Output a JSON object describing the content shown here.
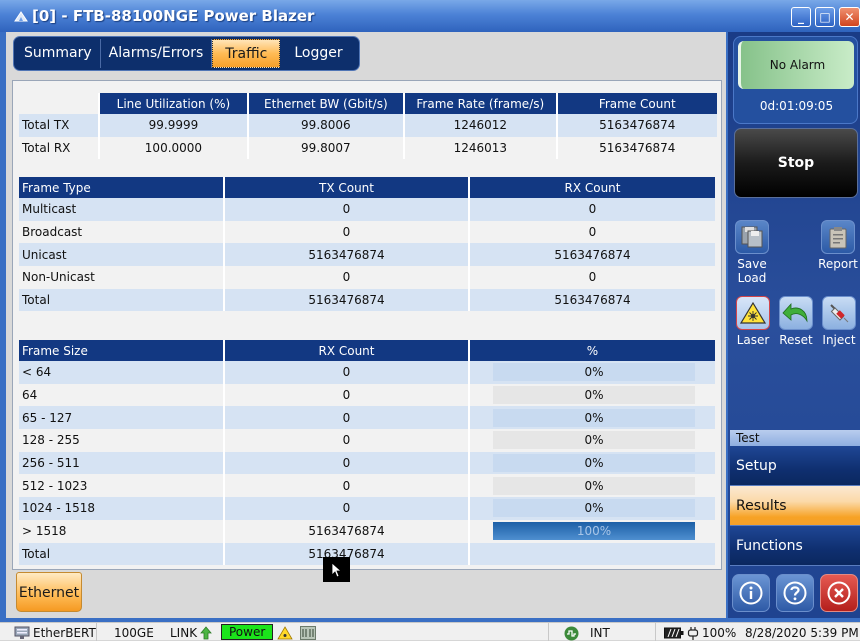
{
  "window": {
    "title": "[0] - FTB-88100NGE Power Blazer",
    "minimize_glyph": "_",
    "maximize_glyph": "□",
    "close_glyph": "✕"
  },
  "tabs": [
    {
      "label": "Summary",
      "active": false
    },
    {
      "label": "Alarms/Errors",
      "active": false
    },
    {
      "label": "Traffic",
      "active": true
    },
    {
      "label": "Logger",
      "active": false
    }
  ],
  "summary_table": {
    "headers": [
      "",
      "Line Utilization (%)",
      "Ethernet BW (Gbit/s)",
      "Frame Rate (frame/s)",
      "Frame Count"
    ],
    "rows": [
      [
        "Total TX",
        "99.9999",
        "99.8006",
        "1246012",
        "5163476874"
      ],
      [
        "Total RX",
        "100.0000",
        "99.8007",
        "1246013",
        "5163476874"
      ]
    ]
  },
  "frame_type_table": {
    "headers": [
      "Frame Type",
      "TX Count",
      "RX Count"
    ],
    "rows": [
      [
        "Multicast",
        "0",
        "0"
      ],
      [
        "Broadcast",
        "0",
        "0"
      ],
      [
        "Unicast",
        "5163476874",
        "5163476874"
      ],
      [
        "Non-Unicast",
        "0",
        "0"
      ],
      [
        "Total",
        "5163476874",
        "5163476874"
      ]
    ]
  },
  "frame_size_table": {
    "headers": [
      "Frame Size",
      "RX Count",
      "%"
    ],
    "rows": [
      {
        "size": "< 64",
        "count": "0",
        "pct_label": "0%",
        "pct": 0
      },
      {
        "size": "64",
        "count": "0",
        "pct_label": "0%",
        "pct": 0
      },
      {
        "size": "65 - 127",
        "count": "0",
        "pct_label": "0%",
        "pct": 0
      },
      {
        "size": "128 - 255",
        "count": "0",
        "pct_label": "0%",
        "pct": 0
      },
      {
        "size": "256 - 511",
        "count": "0",
        "pct_label": "0%",
        "pct": 0
      },
      {
        "size": "512 - 1023",
        "count": "0",
        "pct_label": "0%",
        "pct": 0
      },
      {
        "size": "1024 - 1518",
        "count": "0",
        "pct_label": "0%",
        "pct": 0
      },
      {
        "size": "> 1518",
        "count": "5163476874",
        "pct_label": "100%",
        "pct": 100
      }
    ],
    "total": {
      "label": "Total",
      "count": "5163476874"
    }
  },
  "bottom_tab": {
    "label": "Ethernet"
  },
  "right_panel": {
    "alarm_status": "No Alarm",
    "timer": "0d:01:09:05",
    "stop_label": "Stop",
    "tools": {
      "save_load": "Save\nLoad",
      "save": "Save",
      "load": "Load",
      "report": "Report",
      "laser": "Laser",
      "reset": "Reset",
      "inject": "Inject"
    },
    "test_menu": {
      "header": "Test",
      "items": [
        {
          "label": "Setup",
          "active": false
        },
        {
          "label": "Results",
          "active": true
        },
        {
          "label": "Functions",
          "active": false
        }
      ]
    }
  },
  "statusbar": {
    "app": "EtherBERT",
    "rate": "100GE",
    "link": "LINK",
    "power": "Power",
    "clock_source": "INT",
    "battery": "100%",
    "datetime": "8/28/2020 5:39 PM"
  },
  "colors": {
    "accent_orange": "#f7a02a",
    "header_navy": "#123882",
    "alarm_green": "#86c28a",
    "power_green": "#1be41b",
    "exit_red": "#b41f1c"
  }
}
